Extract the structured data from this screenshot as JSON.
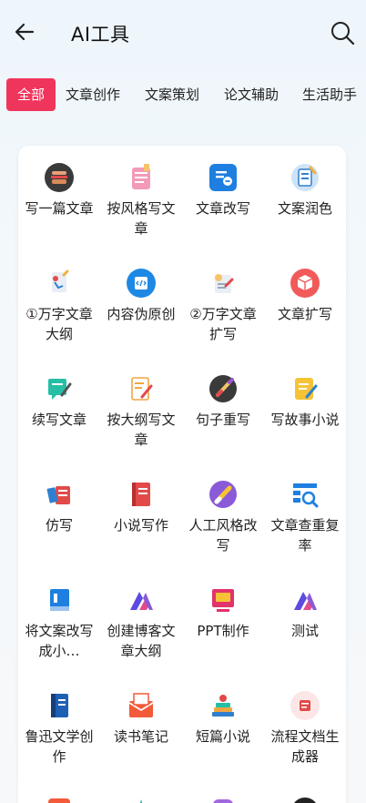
{
  "header": {
    "title": "AI工具"
  },
  "tabs": [
    "全部",
    "文章创作",
    "文案策划",
    "论文辅助",
    "生活助手"
  ],
  "tools": [
    {
      "label": "写一篇文章",
      "icon": "burger-icon"
    },
    {
      "label": "按风格写文章",
      "icon": "style-doc-icon"
    },
    {
      "label": "文章改写",
      "icon": "rewrite-icon"
    },
    {
      "label": "文案润色",
      "icon": "polish-icon"
    },
    {
      "label": "①万字文章大纲",
      "icon": "outline-icon"
    },
    {
      "label": "内容伪原创",
      "icon": "code-icon"
    },
    {
      "label": "②万字文章扩写",
      "icon": "expand-doc-icon"
    },
    {
      "label": "文章扩写",
      "icon": "cube-icon"
    },
    {
      "label": "续写文章",
      "icon": "continue-icon"
    },
    {
      "label": "按大纲写文章",
      "icon": "outline-write-icon"
    },
    {
      "label": "句子重写",
      "icon": "pen-icon"
    },
    {
      "label": "写故事小说",
      "icon": "story-icon"
    },
    {
      "label": "仿写",
      "icon": "imitate-icon"
    },
    {
      "label": "小说写作",
      "icon": "book-icon"
    },
    {
      "label": "人工风格改写",
      "icon": "pen-circle-icon"
    },
    {
      "label": "文章查重复率",
      "icon": "check-icon"
    },
    {
      "label": "将文案改写成小…",
      "icon": "blue-book-icon"
    },
    {
      "label": "创建博客文章大纲",
      "icon": "brand-icon"
    },
    {
      "label": "PPT制作",
      "icon": "ppt-icon"
    },
    {
      "label": "测试",
      "icon": "brand-icon"
    },
    {
      "label": "鲁迅文学创作",
      "icon": "notebook-icon"
    },
    {
      "label": "读书笔记",
      "icon": "mail-icon"
    },
    {
      "label": "短篇小说",
      "icon": "books-icon"
    },
    {
      "label": "流程文档生成器",
      "icon": "flow-icon"
    }
  ]
}
